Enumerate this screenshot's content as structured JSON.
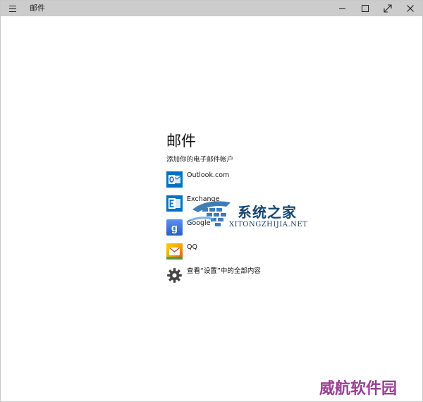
{
  "window": {
    "title": "邮件",
    "controls": {
      "minimize": "minimize",
      "maximize": "maximize",
      "fullscreen": "fullscreen",
      "close": "close"
    }
  },
  "main": {
    "heading": "邮件",
    "subtitle": "添加你的电子邮件帐户",
    "accounts": [
      {
        "label": "Outlook.com",
        "icon": "outlook-icon",
        "color": "#0072c6"
      },
      {
        "label": "Exchange",
        "icon": "exchange-icon",
        "color": "#0072c6"
      },
      {
        "label": "Google",
        "icon": "google-icon",
        "color": "#3b6fd6"
      },
      {
        "label": "QQ",
        "icon": "qq-mail-icon",
        "color": "#f0b400"
      }
    ],
    "settings_link": {
      "label": "查看“设置”中的全部内容",
      "icon": "gear-icon"
    }
  },
  "watermarks": {
    "site_cn": "系统之家",
    "site_en": "XITONGZHIJIA.NET",
    "corner": "威航软件园"
  },
  "colors": {
    "titlebar": "#cccccc",
    "accent": "#0072c6",
    "watermark_blue": "#16456e",
    "watermark_purple": "#9a3f94"
  }
}
